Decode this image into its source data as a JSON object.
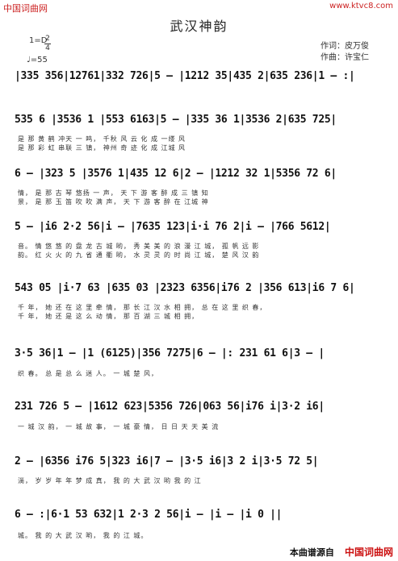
{
  "header": {
    "watermark_left": "中国词曲网",
    "watermark_right": "www.ktvc8.com",
    "title": "武汉神韵",
    "key": "1=D",
    "time_top": "2",
    "time_bottom": "4",
    "tempo": "♩=55",
    "lyricist": "作词：皮万俊",
    "composer": "作曲：许宝仁"
  },
  "score": [
    {
      "notes": "|335 356|12761|332 726|5 – |1212 35|435 2|635 236|1 – :|",
      "lyrics": []
    },
    {
      "notes": "535 6 |3536 1 |553 6163|5 – |335 36 1|3536 2|635 725|",
      "lyrics": [
        "是 那 黄 鹤 冲天 一 鸣， 千秋 风 云 化 成 一缕 风",
        "是 那 彩 虹 串联 三 镇， 神州 奇 迹 化 成 江城 风"
      ]
    },
    {
      "notes": "6 – |323 5 |3576 1|435 12 6|2 – |1212 32 1|5356 72 6|",
      "lyrics": [
        "情， 是 那 古 琴 悠扬 一 声， 天 下 游 客 醉 成 三 镇 知",
        "景， 是 那 玉 笛 吹 吹 满 声， 天 下 游 客 醉 在 江城 神"
      ]
    },
    {
      "notes": "5 – |i6 2·2 56|i – |7635 123|i·i 76 2|i – |766 5612|",
      "lyrics": [
        "音。 情 悠 悠 的 盘 龙 古 城 哟， 秀 美 美 的 浪 漫 江 城， 孤 帆 远 影",
        "韵。 红 火 火 的 九 省 通 衢 哟， 水 灵 灵 的 时 尚 江 城， 楚 风 汉 韵"
      ]
    },
    {
      "notes": "543 05 |i·7 63 |635 03 |2323 6356|i76 2 |356 613|i6 7 6|",
      "lyrics": [
        "千 年， 她 还 在 这 里 牵 情， 那 长 江 汉 水 相 拥， 总 在 这 里 织 春，",
        "千 年， 她 还 是 这 么 动 情， 那 百 湖 三 城 相 拥，"
      ]
    },
    {
      "notes": "3·5 36|1 – |1 (6125)|356 7275|6 – |: 231 61 6|3 – |",
      "lyrics": [
        "织 春。 总 是 总 么 迷 人。 一 城 楚 风，"
      ]
    },
    {
      "notes": "231 726 5 – |1612 623|5356 726|063 56|i76 i|3·2 i6|",
      "lyrics": [
        "一 城 汉 韵， 一 城 故 事， 一 城 豪 情， 日 日 天 天 美 流"
      ]
    },
    {
      "notes": "2 – |6356 i76 5|323 i6|7 – |3·5 i6|3 2 i|3·5 72 5|",
      "lyrics": [
        "淌， 岁 岁 年 年 梦 成 真， 我 的 大 武 汉 哟 我 的 江"
      ]
    },
    {
      "notes": "6 – :|6·1 53 632|1 2·3 2 56|i – |i – |i 0 ||",
      "lyrics": [
        "城。 我 的 大 武 汉 哟， 我 的 江 城。"
      ]
    }
  ],
  "footer": {
    "label_black": "本曲谱源自",
    "label_red": "中国词曲网"
  }
}
